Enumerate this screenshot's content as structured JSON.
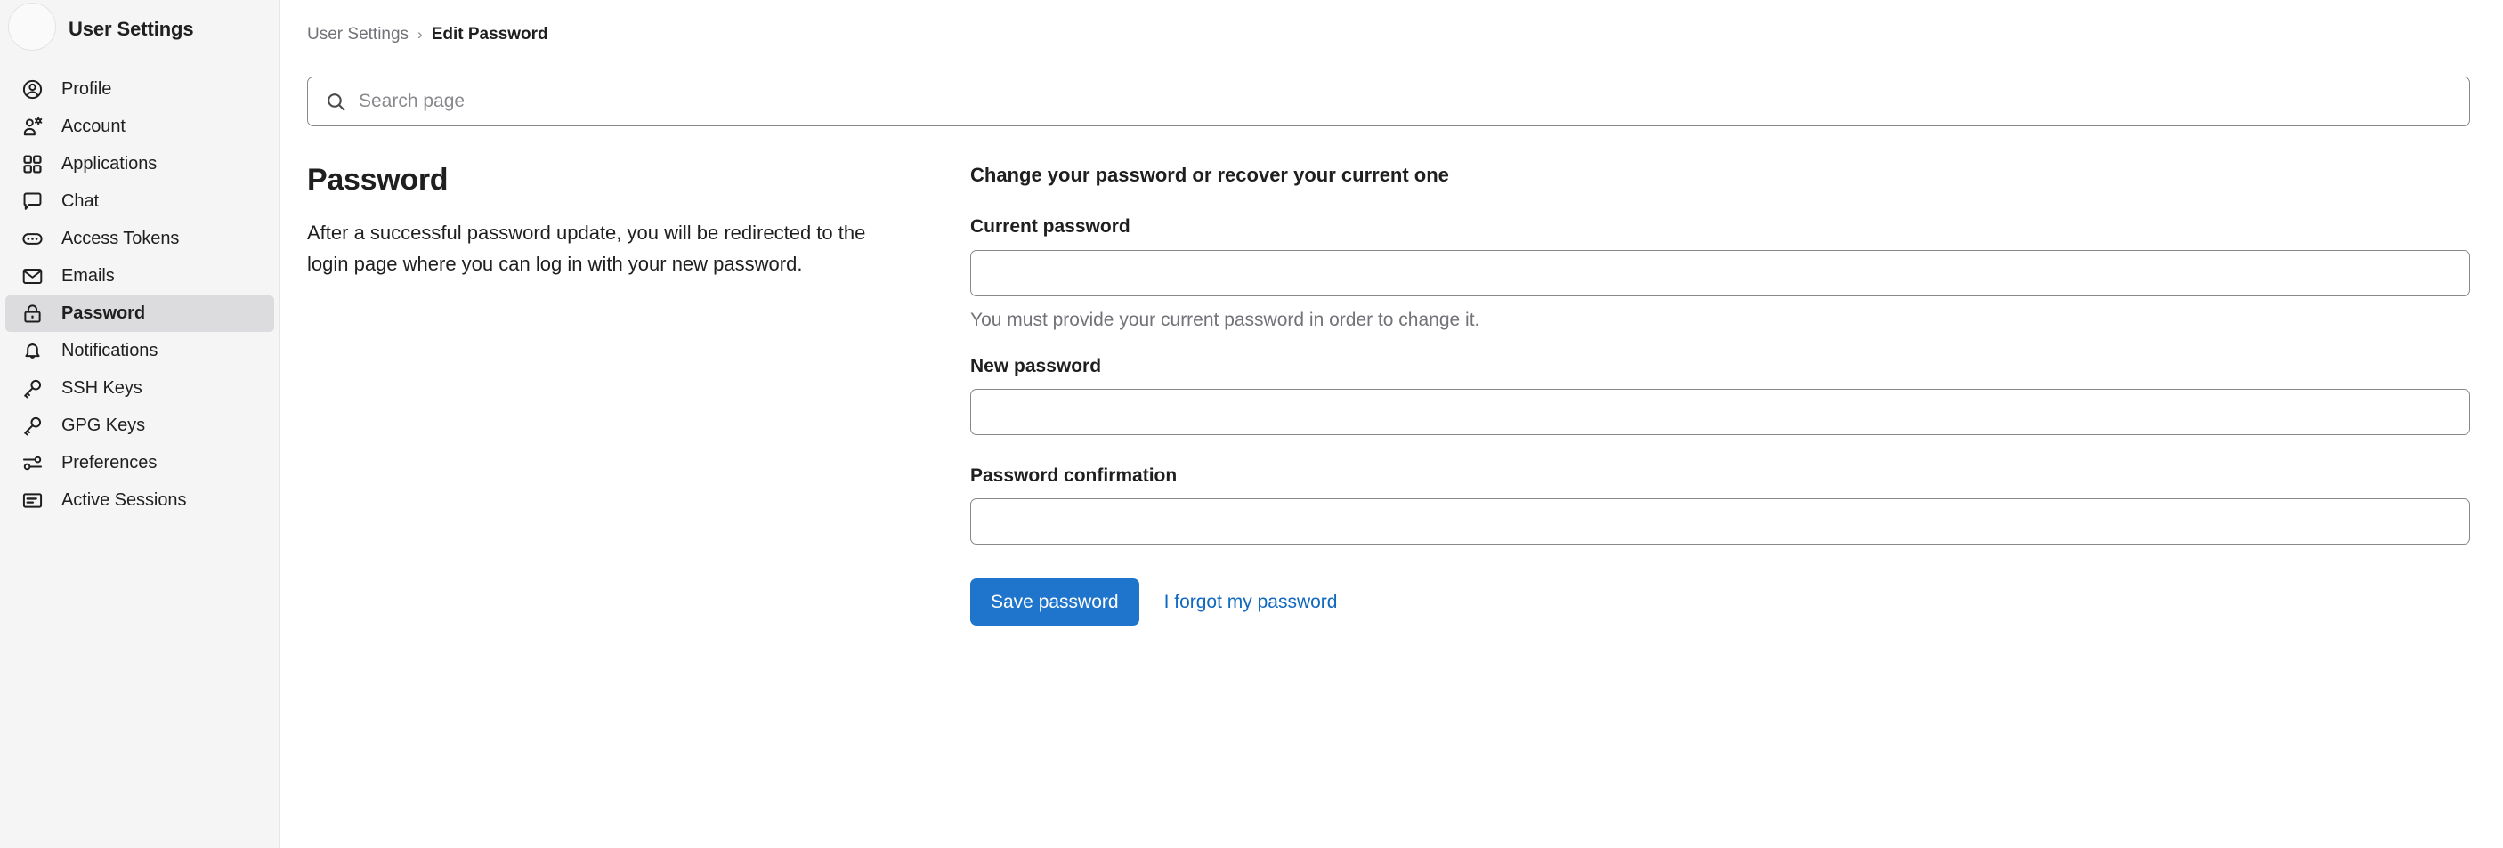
{
  "sidebar": {
    "title": "User Settings",
    "avatar_name": "user-avatar",
    "items": [
      {
        "label": "Profile",
        "icon": "user-circle-icon",
        "active": false
      },
      {
        "label": "Account",
        "icon": "user-gear-icon",
        "active": false
      },
      {
        "label": "Applications",
        "icon": "grid-apps-icon",
        "active": false
      },
      {
        "label": "Chat",
        "icon": "chat-bubble-icon",
        "active": false
      },
      {
        "label": "Access Tokens",
        "icon": "token-ellipsis-icon",
        "active": false
      },
      {
        "label": "Emails",
        "icon": "envelope-icon",
        "active": false
      },
      {
        "label": "Password",
        "icon": "lock-icon",
        "active": true
      },
      {
        "label": "Notifications",
        "icon": "bell-icon",
        "active": false
      },
      {
        "label": "SSH Keys",
        "icon": "key-icon",
        "active": false
      },
      {
        "label": "GPG Keys",
        "icon": "key-icon",
        "active": false
      },
      {
        "label": "Preferences",
        "icon": "sliders-icon",
        "active": false
      },
      {
        "label": "Active Sessions",
        "icon": "document-list-icon",
        "active": false
      }
    ]
  },
  "breadcrumb": {
    "parent": "User Settings",
    "separator": "›",
    "current": "Edit Password"
  },
  "search": {
    "placeholder": "Search page",
    "value": "",
    "icon": "search-icon"
  },
  "section": {
    "title": "Password",
    "description": "After a successful password update, you will be redirected to the login page where you can log in with your new password."
  },
  "form": {
    "heading": "Change your password or recover your current one",
    "fields": [
      {
        "label": "Current password",
        "value": "",
        "help": "You must provide your current password in order to change it."
      },
      {
        "label": "New password",
        "value": "",
        "help": ""
      },
      {
        "label": "Password confirmation",
        "value": "",
        "help": ""
      }
    ],
    "submit_label": "Save password",
    "forgot_link_label": "I forgot my password"
  },
  "colors": {
    "primary_button": "#1f75cb",
    "link": "#1068bf",
    "sidebar_bg": "#f5f5f5",
    "sidebar_active_bg": "#dcdcde",
    "border": "#89888d",
    "muted_text": "#737278"
  }
}
